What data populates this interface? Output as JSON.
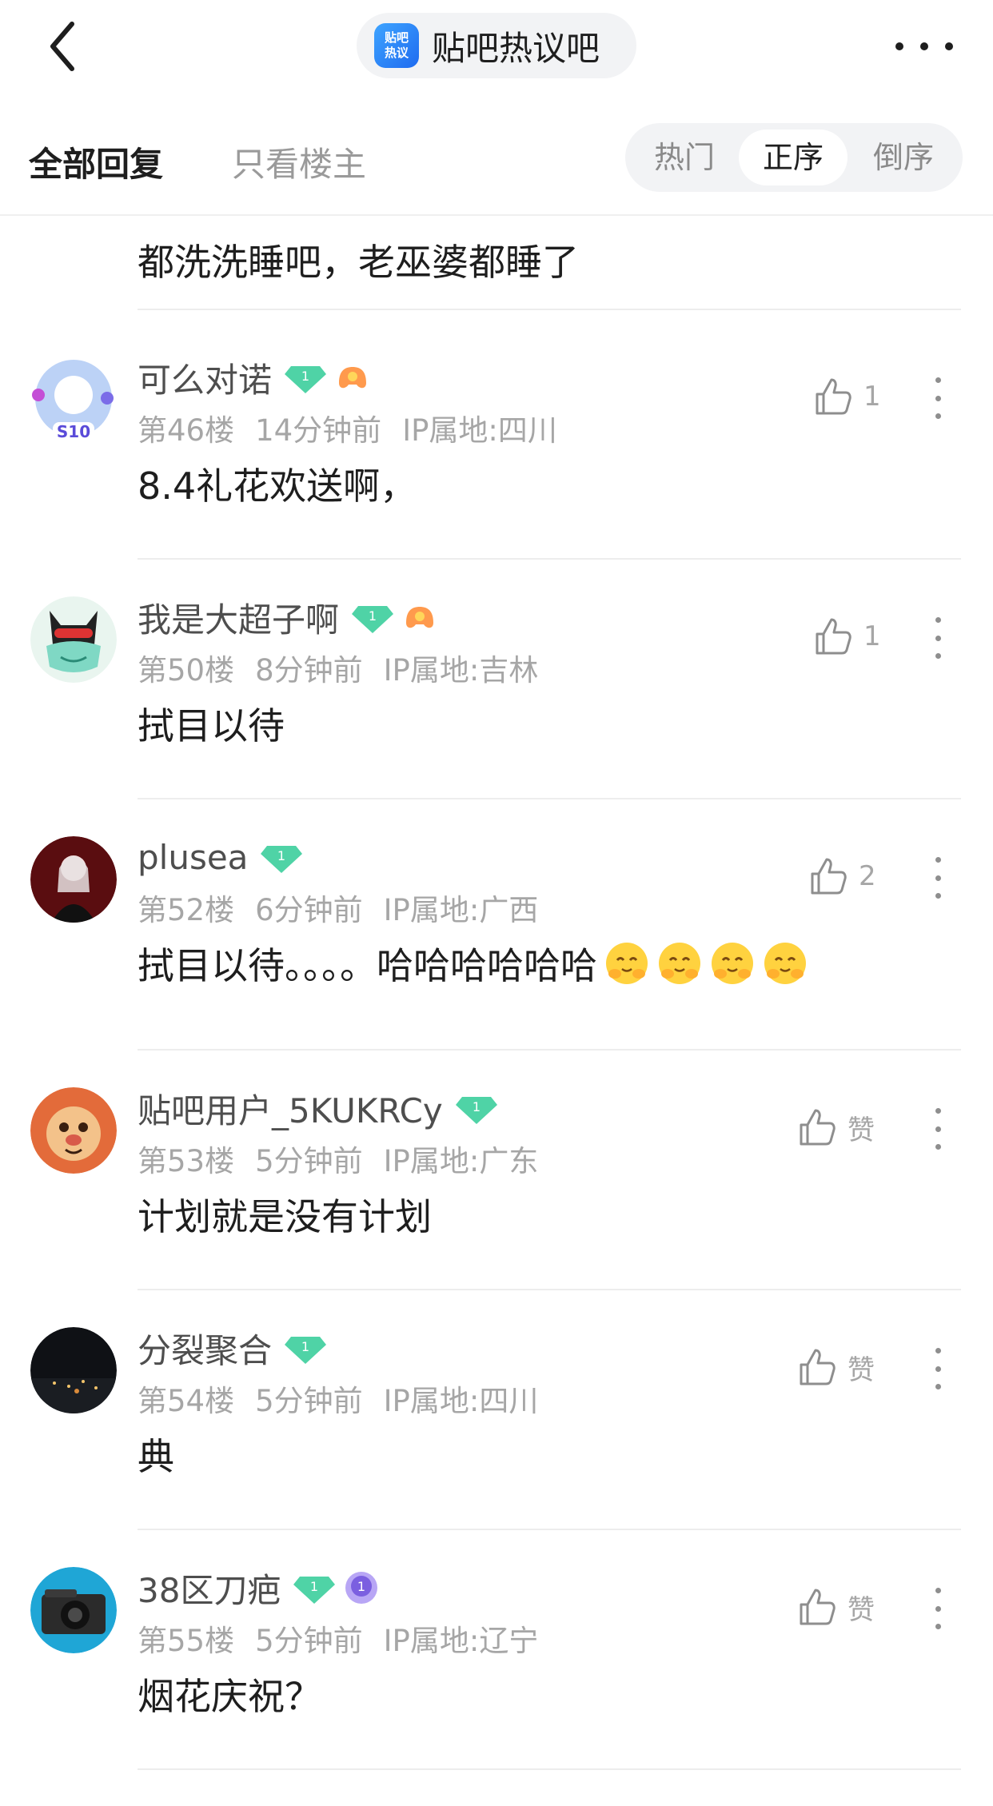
{
  "header": {
    "forum_title": "贴吧热议吧",
    "logo_text_line1": "贴吧",
    "logo_text_line2": "热议",
    "back_icon": "chevron-left-icon",
    "more_icon": "more-horizontal-icon"
  },
  "tabs": {
    "all_replies": "全部回复",
    "owner_only": "只看楼主",
    "sort": {
      "hot": "热门",
      "ascending": "正序",
      "descending": "倒序",
      "selected": "正序"
    }
  },
  "fragment": {
    "content": "都洗洗睡吧，老巫婆都睡了"
  },
  "posts": [
    {
      "username": "可么对诺",
      "level_badge": "1",
      "floor": "第46楼",
      "time": "14分钟前",
      "ip": "IP属地:四川",
      "content": "8.4礼花欢送啊，",
      "likes": "1",
      "extra_badge": "game-controller-badge",
      "avatar_text": "S10"
    },
    {
      "username": "我是大超子啊",
      "level_badge": "1",
      "floor": "第50楼",
      "time": "8分钟前",
      "ip": "IP属地:吉林",
      "content": "拭目以待",
      "likes": "1",
      "extra_badge": "game-controller-badge"
    },
    {
      "username": "plusea",
      "level_badge": "1",
      "floor": "第52楼",
      "time": "6分钟前",
      "ip": "IP属地:广西",
      "content": "拭目以待。。。。哈哈哈哈哈哈",
      "likes": "2",
      "emoji_count": 4
    },
    {
      "username": "贴吧用户_5KUKRCy",
      "level_badge": "1",
      "floor": "第53楼",
      "time": "5分钟前",
      "ip": "IP属地:广东",
      "content": "计划就是没有计划",
      "likes": "赞"
    },
    {
      "username": "分裂聚合",
      "level_badge": "1",
      "floor": "第54楼",
      "time": "5分钟前",
      "ip": "IP属地:四川",
      "content": "典",
      "likes": "赞"
    },
    {
      "username": "38区刀疤",
      "level_badge": "1",
      "floor": "第55楼",
      "time": "5分钟前",
      "ip": "IP属地:辽宁",
      "content": "烟花庆祝？",
      "likes": "赞",
      "extra_badge": "purple-level-badge",
      "extra_badge_text": "1"
    }
  ],
  "colors": {
    "gem_badge": "#4fd3a6",
    "accent_blue": "#1f6bf0",
    "meta_gray": "#a6a6a6"
  }
}
